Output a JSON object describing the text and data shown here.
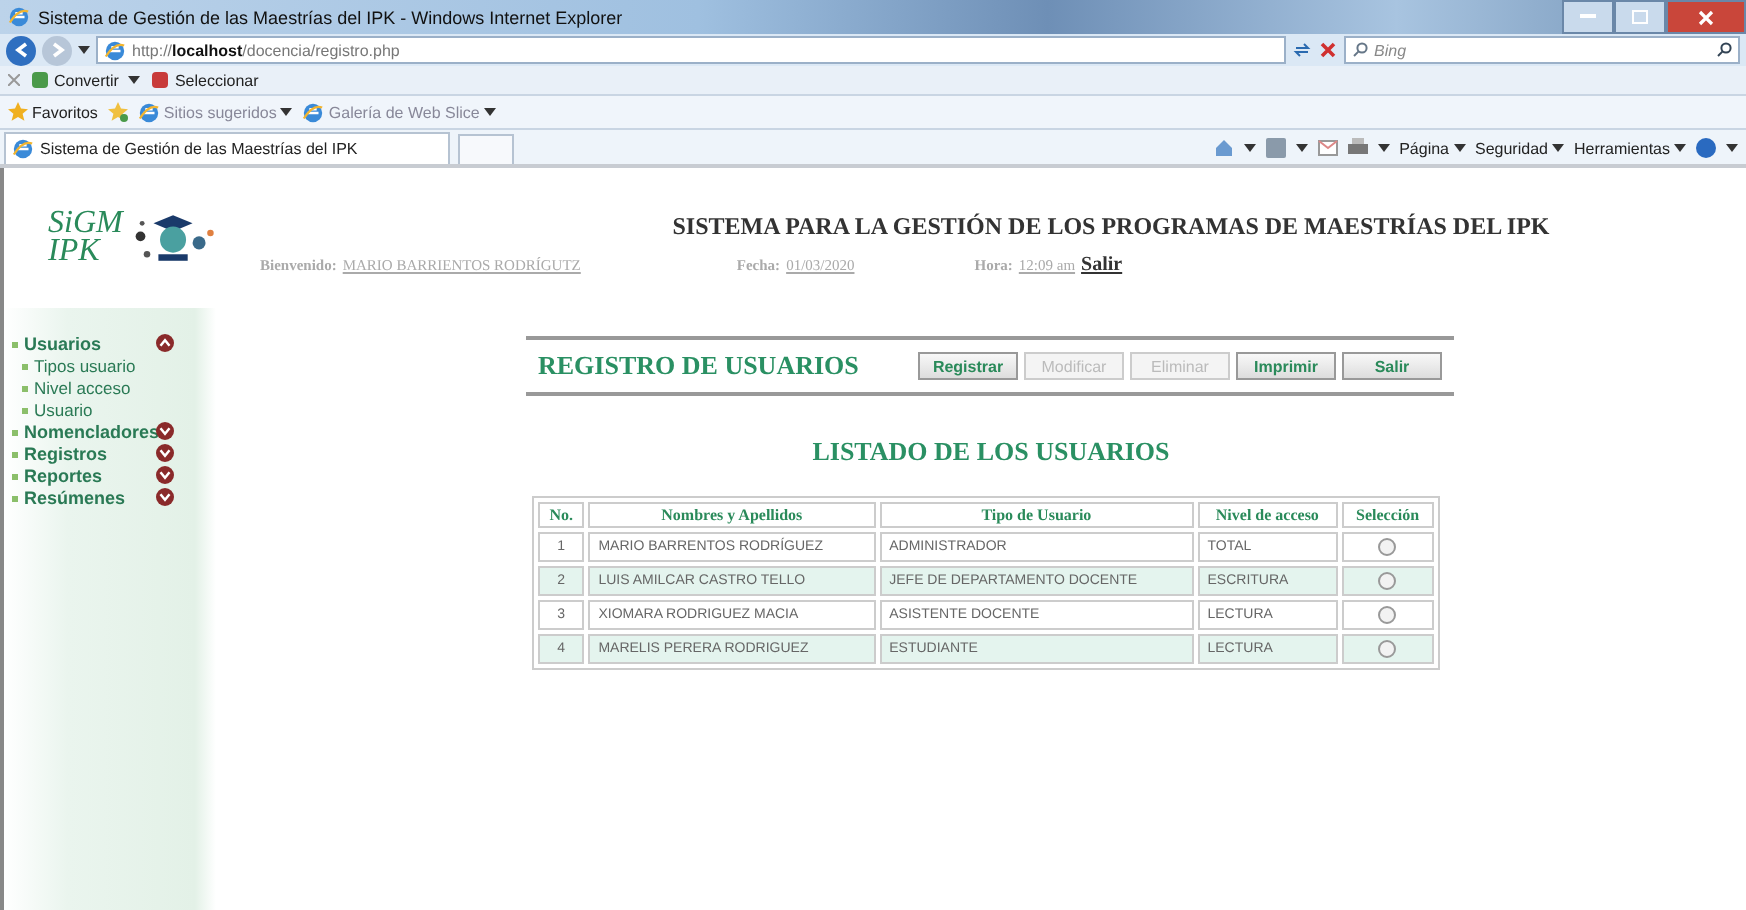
{
  "window": {
    "title": "Sistema de Gestión de las Maestrías del IPK - Windows Internet Explorer"
  },
  "address_bar": {
    "url_prefix": "http://",
    "url_host": "localhost",
    "url_path": "/docencia/registro.php",
    "search_placeholder": "Bing"
  },
  "command_bar": {
    "items": [
      "Convertir",
      "Seleccionar"
    ]
  },
  "favorites_bar": {
    "label": "Favoritos",
    "items": [
      "Sitios sugeridos",
      "Galería de Web Slice"
    ]
  },
  "tabs": [
    {
      "label": "Sistema de Gestión de las Maestrías del IPK",
      "selected": true
    }
  ],
  "toolbar": {
    "items": [
      "Página",
      "Seguridad",
      "Herramientas"
    ]
  },
  "logo": {
    "line1": "SiGM",
    "line2": "IPK"
  },
  "header": {
    "title": "SISTEMA PARA LA GESTIÓN DE LOS PROGRAMAS DE MAESTRÍAS DEL IPK",
    "welcome_label": "Bienvenido:",
    "user": "MARIO BARRIENTOS RODRÍGUTZ",
    "date_label": "Fecha:",
    "date": "01/03/2020",
    "time_label": "Hora:",
    "time": "12:09 am",
    "logout": "Salir"
  },
  "sidebar": {
    "items": [
      {
        "label": "Usuarios",
        "expanded": true,
        "children": [
          {
            "label": "Tipos usuario"
          },
          {
            "label": "Nivel acceso"
          },
          {
            "label": "Usuario"
          }
        ]
      },
      {
        "label": "Nomencladores",
        "expanded": false
      },
      {
        "label": "Registros",
        "expanded": false
      },
      {
        "label": "Reportes",
        "expanded": false
      },
      {
        "label": "Resúmenes",
        "expanded": false
      }
    ]
  },
  "form": {
    "title": "REGISTRO DE USUARIOS",
    "buttons": [
      {
        "label": "Registrar",
        "disabled": false
      },
      {
        "label": "Modificar",
        "disabled": true
      },
      {
        "label": "Eliminar",
        "disabled": true
      },
      {
        "label": "Imprimir",
        "disabled": false
      },
      {
        "label": "Salir",
        "disabled": false
      }
    ]
  },
  "table": {
    "title": "LISTADO DE LOS USUARIOS",
    "columns": [
      "No.",
      "Nombres y Apellidos",
      "Tipo de Usuario",
      "Nivel de acceso",
      "Selección"
    ],
    "rows": [
      {
        "no": "1",
        "name": "MARIO BARRENTOS RODRÍGUEZ",
        "type": "ADMINISTRADOR",
        "level": "TOTAL",
        "selected": false
      },
      {
        "no": "2",
        "name": "LUIS AMILCAR CASTRO TELLO",
        "type": "JEFE DE DEPARTAMENTO DOCENTE",
        "level": "ESCRITURA",
        "selected": false
      },
      {
        "no": "3",
        "name": "XIOMARA RODRIGUEZ MACIA",
        "type": "ASISTENTE DOCENTE",
        "level": "LECTURA",
        "selected": false
      },
      {
        "no": "4",
        "name": "MARELIS PERERA RODRIGUEZ",
        "type": "ESTUDIANTE",
        "level": "LECTURA",
        "selected": false
      }
    ]
  }
}
